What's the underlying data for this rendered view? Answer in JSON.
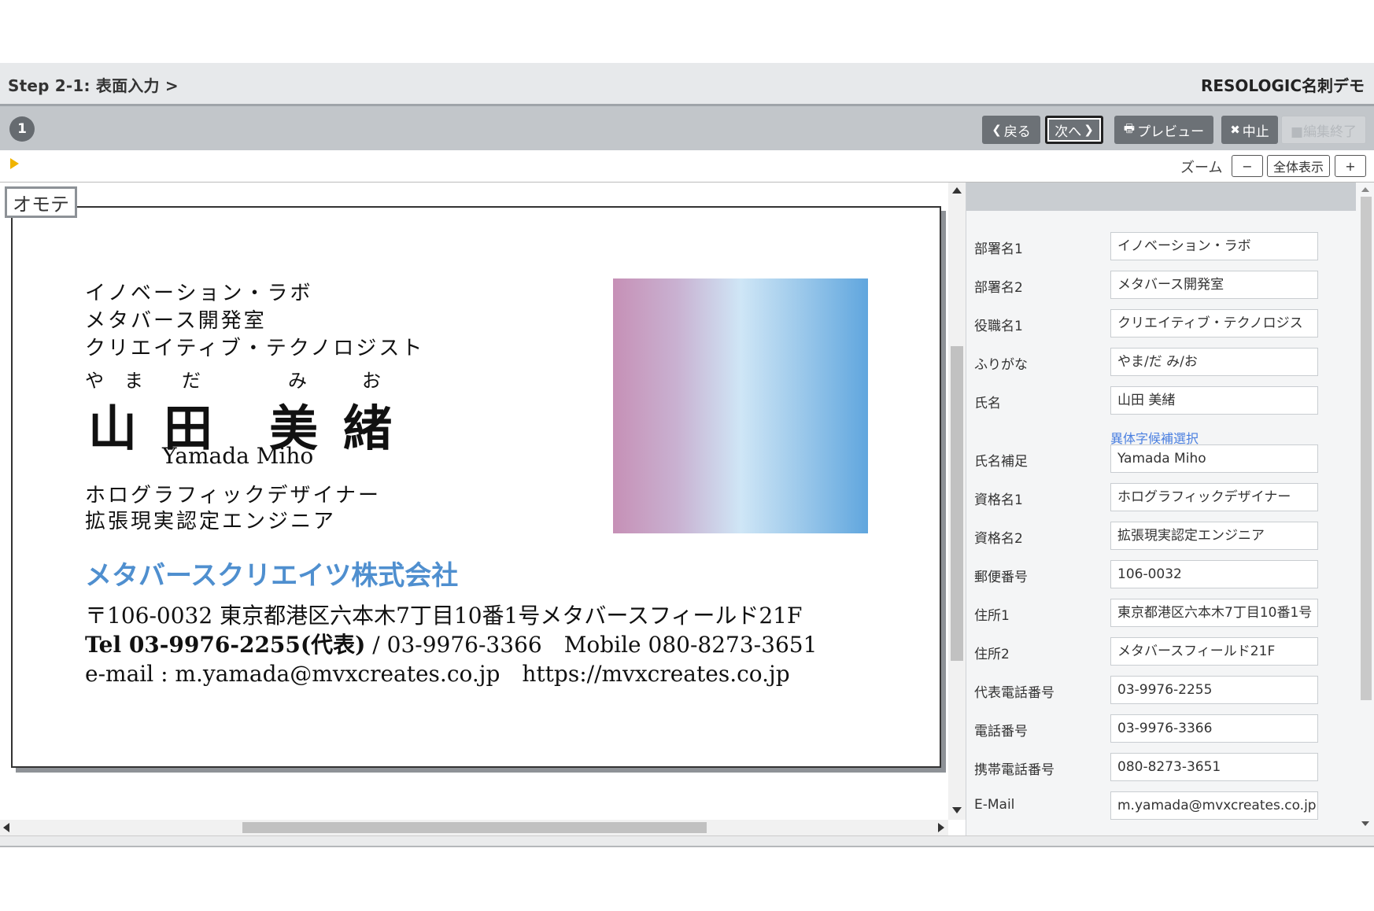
{
  "header": {
    "step_title": "Step 2-1: 表面入力 >",
    "app_title": "RESOLOGIC名刺デモ"
  },
  "toolbar": {
    "step_number": "1",
    "back_label": "戻る",
    "next_label": "次へ",
    "preview_label": "プレビュー",
    "cancel_label": "中止",
    "finish_label": "■編集終了"
  },
  "zoom": {
    "label": "ズーム",
    "minus": "−",
    "fit_label": "全体表示",
    "plus": "+"
  },
  "canvas": {
    "side_label": "オモテ"
  },
  "card": {
    "dept1": "イノベーション・ラボ",
    "dept2": "メタバース開発室",
    "title1": "クリエイティブ・テクノロジスト",
    "furigana": [
      "や",
      "ま",
      "だ",
      "み",
      "お"
    ],
    "name_chars": [
      "山",
      "田",
      "美",
      "緒"
    ],
    "name_roman": "Yamada Miho",
    "qual1": "ホログラフィックデザイナー",
    "qual2": "拡張現実認定エンジニア",
    "company": "メタバースクリエイツ株式会社",
    "address_line": "〒106-0032 東京都港区六本木7丁目10番1号メタバースフィールド21F",
    "tel_main": "Tel 03-9976-2255(代表)",
    "tel_rest": " / 03-9976-3366　Mobile 080-8273-3651",
    "web_line": "e-mail : m.yamada@mvxcreates.co.jp　https://mvxcreates.co.jp",
    "gradient_colors": [
      "#c690b6",
      "#cfe6f6",
      "#60a6de"
    ]
  },
  "fields": [
    {
      "label": "部署名1",
      "value": "イノベーション・ラボ"
    },
    {
      "label": "部署名2",
      "value": "メタバース開発室"
    },
    {
      "label": "役職名1",
      "value": "クリエイティブ・テクノロジス"
    },
    {
      "label": "ふりがな",
      "value": "やま/だ み/お"
    },
    {
      "label": "氏名",
      "value": "山田 美緒"
    },
    {
      "label": "氏名補足",
      "value": "Yamada Miho"
    },
    {
      "label": "資格名1",
      "value": "ホログラフィックデザイナー"
    },
    {
      "label": "資格名2",
      "value": "拡張現実認定エンジニア"
    },
    {
      "label": "郵便番号",
      "value": "106-0032"
    },
    {
      "label": "住所1",
      "value": "東京都港区六本木7丁目10番1号"
    },
    {
      "label": "住所2",
      "value": "メタバースフィールド21F"
    },
    {
      "label": "代表電話番号",
      "value": "03-9976-2255"
    },
    {
      "label": "電話番号",
      "value": "03-9976-3366"
    },
    {
      "label": "携帯電話番号",
      "value": "080-8273-3651"
    },
    {
      "label": "E-Mail",
      "value": "m.yamada@mvxcreates.co.jp"
    }
  ],
  "variant_link": "異体字候補選択",
  "colors": {
    "accent_blue": "#4f8fcf",
    "link_blue": "#4a7fe0",
    "toolbar_button": "#6c7176",
    "marker_yellow": "#f0b400"
  }
}
